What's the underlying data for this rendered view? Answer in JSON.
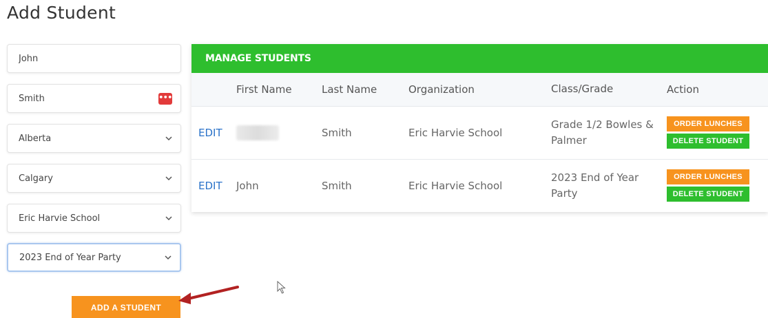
{
  "page": {
    "title": "Add Student"
  },
  "form": {
    "first_name": "John",
    "last_name": "Smith",
    "province": "Alberta",
    "city": "Calgary",
    "school": "Eric Harvie School",
    "class": "2023 End of Year Party",
    "submit_label": "ADD A STUDENT",
    "password_icon": "password-manager-icon"
  },
  "manage": {
    "heading": "MANAGE STUDENTS",
    "columns": [
      "",
      "First Name",
      "Last Name",
      "Organization",
      "Class/Grade",
      "Action"
    ],
    "rows": [
      {
        "edit": "EDIT",
        "first_name": "",
        "first_name_redacted": true,
        "last_name": "Smith",
        "organization": "Eric Harvie School",
        "class": "Grade 1/2 Bowles & Palmer",
        "order_label": "ORDER LUNCHES",
        "delete_label": "DELETE STUDENT"
      },
      {
        "edit": "EDIT",
        "first_name": "John",
        "first_name_redacted": false,
        "last_name": "Smith",
        "organization": "Eric Harvie School",
        "class": "2023 End of Year Party",
        "order_label": "ORDER LUNCHES",
        "delete_label": "DELETE STUDENT"
      }
    ]
  },
  "colors": {
    "orange": "#f7931e",
    "green": "#2ebe2e",
    "link": "#2a72c9",
    "annotation_arrow": "#b22222"
  }
}
